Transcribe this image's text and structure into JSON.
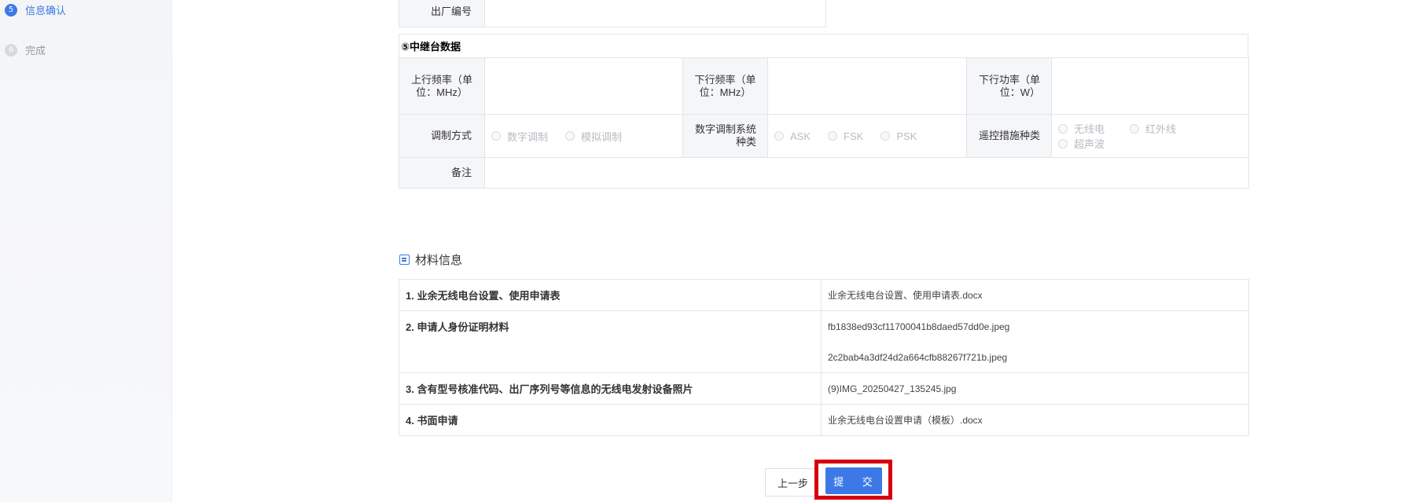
{
  "sidebar": {
    "steps": [
      {
        "num": "5",
        "label": "信息确认",
        "state": "active"
      },
      {
        "num": "6",
        "label": "完成",
        "state": "todo"
      }
    ]
  },
  "device": {
    "serial_label": "出厂编号",
    "serial_value": ""
  },
  "repeater": {
    "title": "⑤中继台数据",
    "uplink_freq_label": "上行频率（单位：MHz）",
    "downlink_freq_label": "下行频率（单位：MHz）",
    "downlink_power_label": "下行功率（单位：W）",
    "modulation_label": "调制方式",
    "modulation_options": [
      "数字调制",
      "模拟调制"
    ],
    "digital_system_label": "数字调制系统种类",
    "digital_system_options": [
      "ASK",
      "FSK",
      "PSK"
    ],
    "remote_label": "遥控措施种类",
    "remote_options": [
      "无线电",
      "红外线",
      "超声波"
    ],
    "remark_label": "备注"
  },
  "materials": {
    "title": "材料信息",
    "rows": [
      {
        "name": "1. 业余无线电台设置、使用申请表",
        "files": [
          "业余无线电台设置、使用申请表.docx"
        ]
      },
      {
        "name": "2. 申请人身份证明材料",
        "files": [
          "fb1838ed93cf11700041b8daed57dd0e.jpeg",
          "2c2bab4a3df24d2a664cfb88267f721b.jpeg"
        ]
      },
      {
        "name": "3. 含有型号核准代码、出厂序列号等信息的无线电发射设备照片",
        "files": [
          "(9)IMG_20250427_135245.jpg"
        ]
      },
      {
        "name": "4. 书面申请",
        "files": [
          "业余无线电台设置申请（模板）.docx"
        ]
      }
    ]
  },
  "actions": {
    "prev_label": "上一步",
    "submit_label": "提 交"
  },
  "colors": {
    "accent": "#3c79e6",
    "highlight": "#d6000f"
  }
}
